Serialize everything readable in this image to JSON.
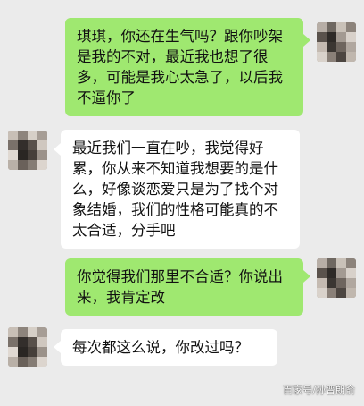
{
  "colors": {
    "background": "#ebebeb",
    "sent_bubble": "#9fe870",
    "received_bubble": "#ffffff",
    "text": "#111111"
  },
  "messages": [
    {
      "sender": "self",
      "lines": [
        "琪琪，你还在生气吗？跟你吵架",
        "是我的不对，最近我也想了很",
        "多，可能是我心太急了，以后我",
        "不逼你了"
      ]
    },
    {
      "sender": "other",
      "lines": [
        "最近我们一直在吵，我觉得好",
        "累，你从来不知道我想要的是什",
        "么，好像谈恋爱只是为了找个对",
        "象结婚，我们的性格可能真的不",
        "太合适，分手吧"
      ]
    },
    {
      "sender": "self",
      "lines": [
        "你觉得我们那里不合适？你说出",
        "来，我肯定改"
      ]
    },
    {
      "sender": "other",
      "lines": [
        "每次都这么说，你改过吗？"
      ]
    }
  ],
  "watermark": "百家号/孙晋朗俞"
}
